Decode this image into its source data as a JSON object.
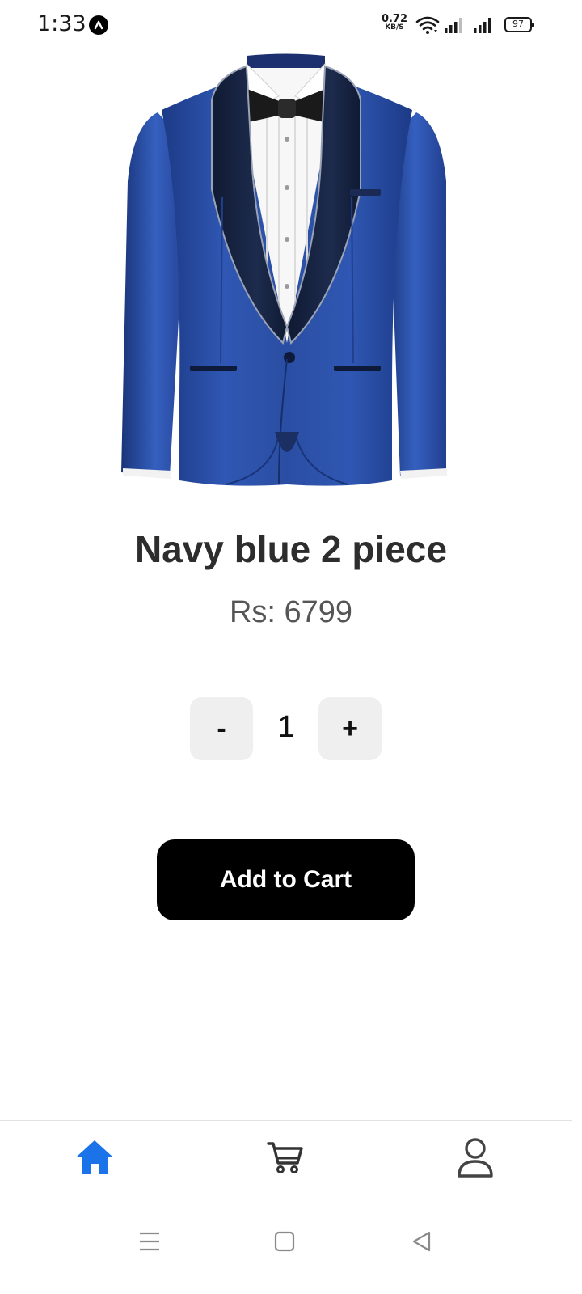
{
  "status_bar": {
    "time": "1:33",
    "net_speed_value": "0.72",
    "net_speed_unit": "KB/S",
    "battery": "97"
  },
  "product": {
    "title": "Navy blue 2 piece",
    "price": "Rs: 6799",
    "image_icon": "navy-tuxedo-jacket"
  },
  "quantity": {
    "decrement_label": "-",
    "value": "1",
    "increment_label": "+"
  },
  "actions": {
    "add_to_cart_label": "Add to Cart"
  },
  "tab_bar": {
    "items": [
      {
        "icon": "home-icon",
        "active": true
      },
      {
        "icon": "cart-icon",
        "active": false
      },
      {
        "icon": "profile-icon",
        "active": false
      }
    ],
    "active_color": "#1a73e8",
    "inactive_color": "#333333"
  },
  "system_nav": {
    "buttons": [
      "menu-icon",
      "home-square-icon",
      "back-triangle-icon"
    ]
  },
  "colors": {
    "primary_button": "#000000",
    "qty_button_bg": "#efefef",
    "suit_blue": "#2a4ea3"
  }
}
